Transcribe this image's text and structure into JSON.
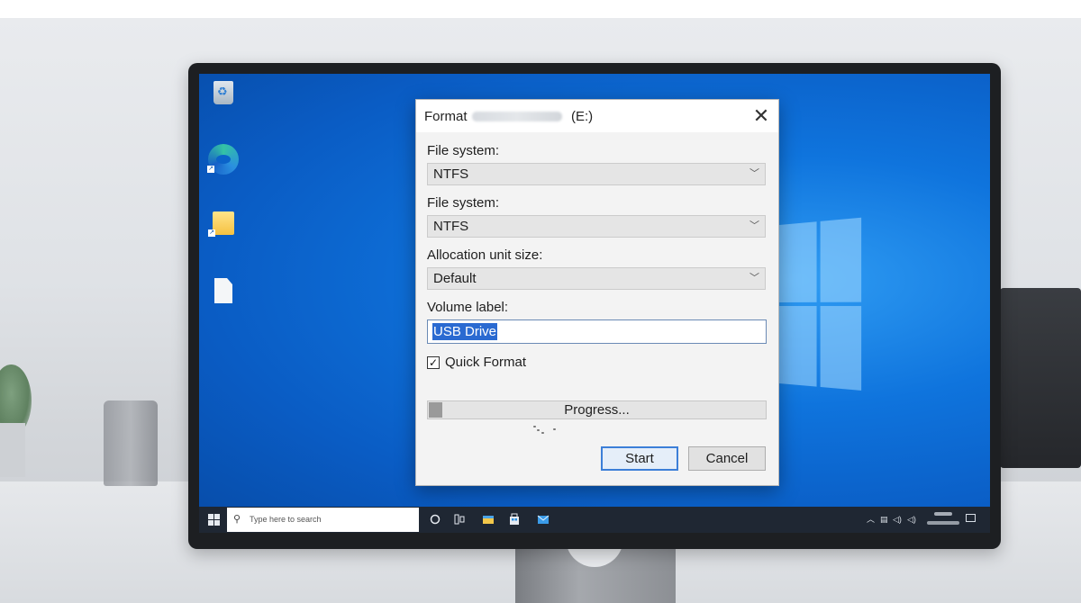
{
  "dialog": {
    "title_prefix": "Format",
    "title_drive": "(E:)",
    "close_glyph": "✕",
    "fields": [
      {
        "label": "File system:",
        "value": "NTFS"
      },
      {
        "label": "File system:",
        "value": "NTFS"
      },
      {
        "label": "Allocation unit size:",
        "value": "Default"
      }
    ],
    "volume_label": {
      "label": "Volume label:",
      "value": "USB Drive"
    },
    "quick_format": {
      "label": "Quick Format",
      "checked": true,
      "glyph": "☑"
    },
    "progress": {
      "label": "Progress...",
      "fraction": 0.04
    },
    "buttons": {
      "start": "Start",
      "cancel": "Cancel"
    },
    "dropdown_glyph": "﹀"
  },
  "taskbar": {
    "search_placeholder": "Type here to search",
    "search_icon": "search-icon",
    "start_icon": "windows-start-icon",
    "pinned": [
      "cortana-icon",
      "task-view-icon",
      "file-explorer-icon",
      "store-icon",
      "mail-icon"
    ],
    "tray_icons": [
      "chevron-up-icon",
      "network-icon",
      "volume-icon",
      "speaker-icon"
    ],
    "notification_icon": "notification-icon"
  },
  "desktop": {
    "icons": [
      "recycle-bin-icon",
      "edge-icon",
      "folder-icon",
      "file-icon"
    ]
  },
  "colors": {
    "desktop_blue": "#0f74dd",
    "taskbar": "#1f2733",
    "selection": "#2a6ad1",
    "focus_border": "#3c7fd8"
  }
}
